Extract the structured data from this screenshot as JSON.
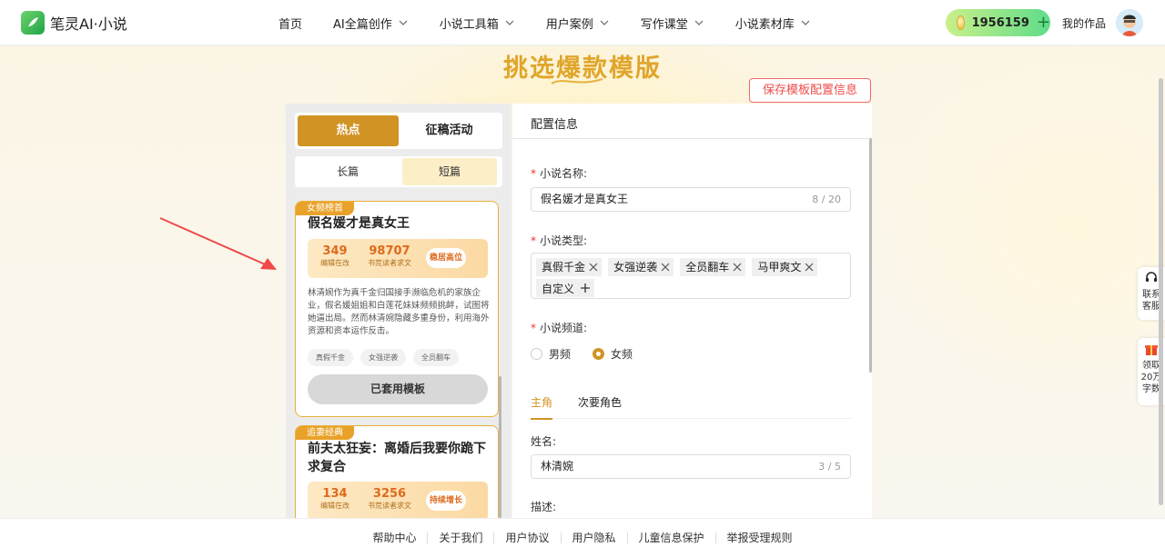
{
  "header": {
    "logo_text": "笔灵AI·小说",
    "nav": [
      {
        "label": "首页",
        "has_menu": false
      },
      {
        "label": "AI全篇创作",
        "has_menu": true
      },
      {
        "label": "小说工具箱",
        "has_menu": true
      },
      {
        "label": "用户案例",
        "has_menu": true
      },
      {
        "label": "写作课堂",
        "has_menu": true
      },
      {
        "label": "小说素材库",
        "has_menu": true
      }
    ],
    "coins": "1956159",
    "my_works": "我的作品"
  },
  "page": {
    "title": "挑选爆款模版",
    "save_button": "保存模板配置信息"
  },
  "left_panel": {
    "top_tabs": [
      "热点",
      "征稿活动"
    ],
    "sub_tabs": [
      "长篇",
      "短篇"
    ],
    "cards": [
      {
        "tag": "女频榜首",
        "title": "假名媛才是真女王",
        "stat1_num": "349",
        "stat1_label": "编辑在改",
        "stat2_num": "98707",
        "stat2_label": "书荒读者求文",
        "badge": "稳居高位",
        "desc": "林清婉作为真千金归国接手濒临危机的家族企业，假名媛姐姐和白莲花妹妹频频挑衅，试图将她逼出局。然而林清婉隐藏多重身份，利用海外资源和资本运作反击。",
        "tags": [
          "真假千金",
          "女强逆袭",
          "全员翻车"
        ],
        "button": "已套用模板"
      },
      {
        "tag": "追妻经典",
        "title": "前夫太狂妄：离婚后我要你跪下求复合",
        "stat1_num": "134",
        "stat1_label": "编辑在改",
        "stat2_num": "3256",
        "stat2_label": "书荒读者求文",
        "badge": "持续增长"
      }
    ]
  },
  "config": {
    "heading": "配置信息",
    "name_label": "小说名称:",
    "name_value": "假名媛才是真女王",
    "name_count": "8 / 20",
    "type_label": "小说类型:",
    "types": [
      "真假千金",
      "女强逆袭",
      "全员翻车",
      "马甲爽文"
    ],
    "custom_label": "自定义",
    "channel_label": "小说频道:",
    "channel_options": [
      "男频",
      "女频"
    ],
    "channel_selected": "女频",
    "role_tabs": [
      "主角",
      "次要角色"
    ],
    "person_name_label": "姓名:",
    "person_name_value": "林清婉",
    "person_name_count": "3 / 5",
    "desc_label": "描述:"
  },
  "side": {
    "service": "联系客服",
    "service_lines": [
      "联系",
      "客服"
    ],
    "reward_lines": [
      "领取",
      "20万",
      "字数"
    ]
  },
  "footer": [
    "帮助中心",
    "关于我们",
    "用户协议",
    "用户隐私",
    "儿童信息保护",
    "举报受理规则"
  ],
  "colors": {
    "accent": "#d19324",
    "brand_green": "#1ea34a",
    "danger": "#ef4c4c"
  }
}
